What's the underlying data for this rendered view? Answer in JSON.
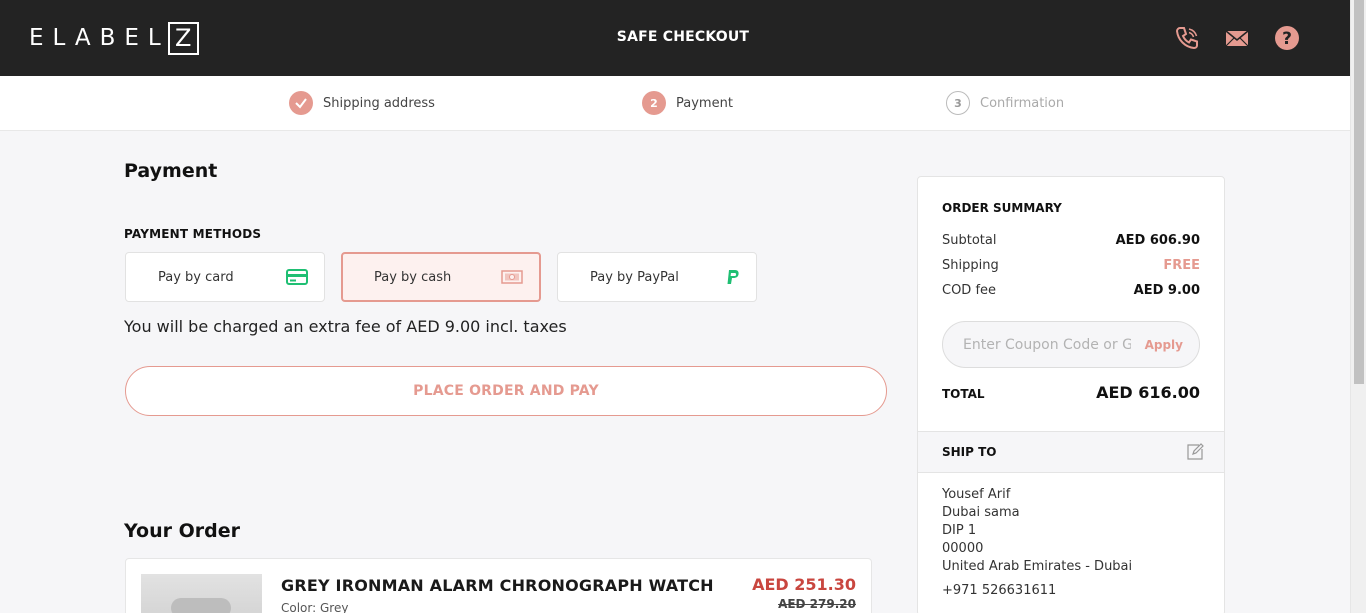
{
  "header": {
    "logo_text": "ELABEL",
    "logo_boxed": "Z",
    "title": "SAFE CHECKOUT",
    "icons": [
      "phone-icon",
      "mail-icon",
      "help-icon"
    ]
  },
  "steps": [
    {
      "number": "✓",
      "label": "Shipping address",
      "state": "done"
    },
    {
      "number": "2",
      "label": "Payment",
      "state": "active"
    },
    {
      "number": "3",
      "label": "Confirmation",
      "state": "todo"
    }
  ],
  "payment": {
    "heading": "Payment",
    "methods_heading": "PAYMENT METHODS",
    "methods": [
      {
        "label": "Pay by card",
        "icon": "credit-card-icon",
        "selected": false
      },
      {
        "label": "Pay by cash",
        "icon": "cash-icon",
        "selected": true
      },
      {
        "label": "Pay by PayPal",
        "icon": "paypal-icon",
        "selected": false
      }
    ],
    "fee_note": "You will be charged an extra fee of AED 9.00 incl. taxes",
    "place_order_label": "PLACE ORDER AND PAY"
  },
  "order": {
    "heading": "Your Order",
    "items": [
      {
        "name": "GREY IRONMAN ALARM CHRONOGRAPH WATCH",
        "color": "Color: Grey",
        "price": "AED 251.30",
        "old_price": "AED 279.20"
      }
    ]
  },
  "summary": {
    "title": "ORDER SUMMARY",
    "rows": [
      {
        "label": "Subtotal",
        "value": "AED 606.90"
      },
      {
        "label": "Shipping",
        "value": "FREE"
      },
      {
        "label": "COD fee",
        "value": "AED 9.00"
      }
    ],
    "coupon_placeholder": "Enter Coupon Code or Gift Card",
    "apply_label": "Apply",
    "total_label": "TOTAL",
    "total_value": "AED 616.00",
    "ship_to_title": "SHIP TO",
    "address_lines": [
      "Yousef Arif",
      "Dubai sama",
      "DIP 1",
      "00000",
      "United Arab Emirates - Dubai"
    ],
    "phone": "+971 526631611"
  },
  "colors": {
    "accent": "#e59a90",
    "header_bg": "#232323",
    "price_red": "#c9463f",
    "card_green": "#1fbf73"
  }
}
